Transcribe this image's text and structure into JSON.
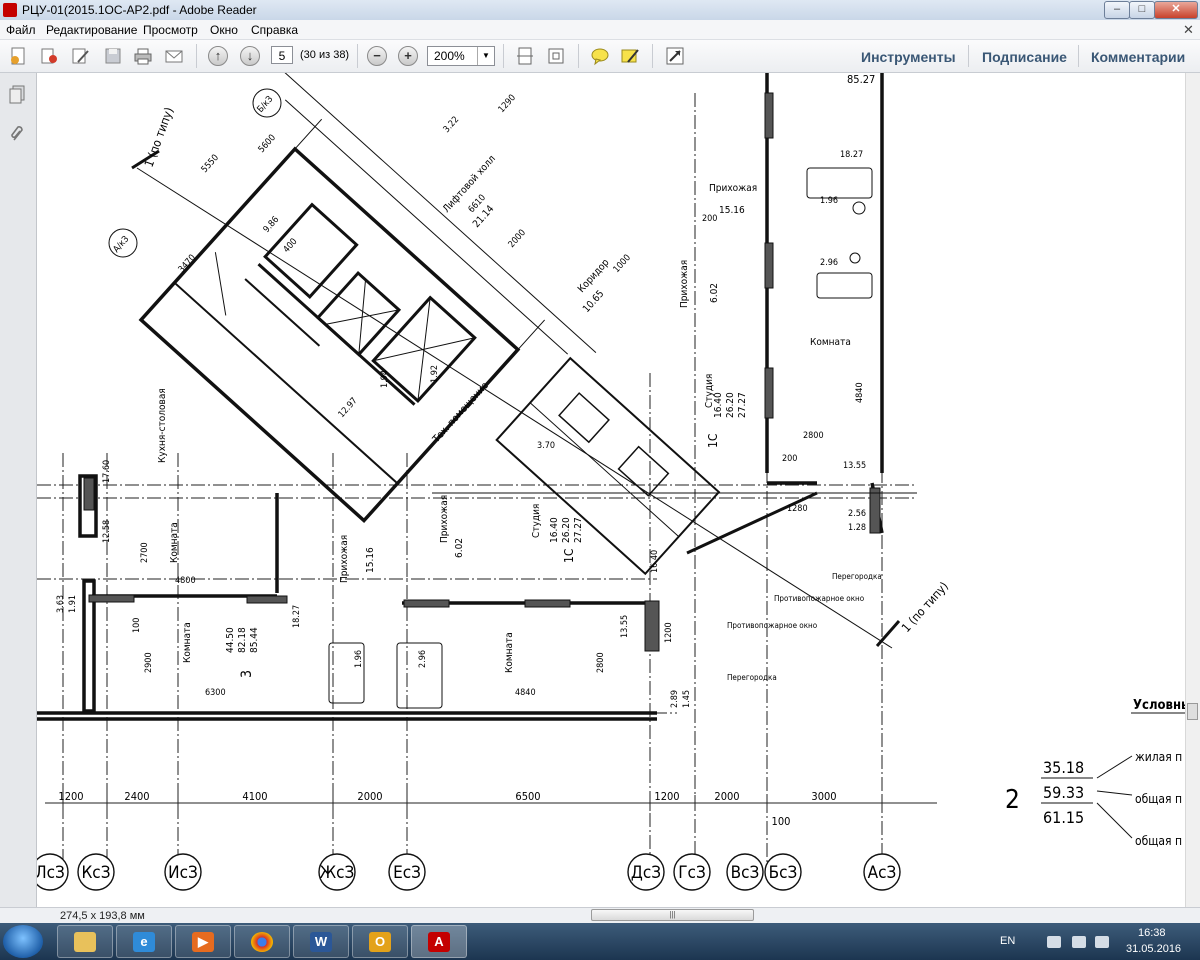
{
  "window": {
    "title": "РЦУ-01(2015.1ОС-АР2.pdf - Adobe Reader",
    "minimize": "–",
    "maximize": "□",
    "close": "✕"
  },
  "menu": {
    "items": [
      "Файл",
      "Редактирование",
      "Просмотр",
      "Окно",
      "Справка"
    ],
    "close_doc": "✕"
  },
  "toolbar": {
    "page_number": "5",
    "page_count": "(30 из 38)",
    "zoom_minus": "−",
    "zoom_plus": "+",
    "zoom": "200%",
    "right_links": [
      "Инструменты",
      "Подписание",
      "Комментарии"
    ]
  },
  "status": {
    "page_size": "274,5 x 193,8 мм",
    "scroll_grip": "|||"
  },
  "taskbar": {
    "lang": "EN",
    "time": "16:38",
    "date": "31.05.2016",
    "apps": [
      "explorer",
      "internet-explorer",
      "media-player",
      "chrome",
      "word",
      "outlook",
      "acrobat-reader"
    ]
  },
  "drawing": {
    "axes": [
      "ЛсЗ",
      "КсЗ",
      "ИсЗ",
      "ЖсЗ",
      "ЕсЗ",
      "ДсЗ",
      "ГсЗ",
      "ВсЗ",
      "БсЗ",
      "АсЗ"
    ],
    "bottom_dims": [
      "1200",
      "2400",
      "4100",
      "2000",
      "6500",
      "1200",
      "2000",
      "3000",
      "100"
    ],
    "apt_number": "2",
    "apt_areas": [
      "35.18",
      "59.33",
      "61.15"
    ],
    "legend_title": "Условные",
    "legend_items": [
      "жилая п",
      "общая п",
      "общая п"
    ],
    "rooms": {
      "kitchen": "Кухня-столовая",
      "room_left": "Комната",
      "room_small": "Комната",
      "hall_mid": "Прихожая",
      "hall_mid_area": "15.16",
      "hall2": "Прихожая",
      "hall2_area": "6.02",
      "studio": "Студия",
      "studio_values": [
        "1С",
        "16.40",
        "26.20",
        "27.27"
      ],
      "room_right": "Комната",
      "hall_right": "Прихожая",
      "hall_right_area": "15.16",
      "studio_r": "Студия",
      "studio_r_values": [
        "1С",
        "16.40",
        "26.20",
        "27.27"
      ],
      "hall_r2": "Прихожая",
      "hall_r2_area": "6.02",
      "room_r": "Комната",
      "apt3_values": [
        "44.50",
        "82.18",
        "85.44"
      ],
      "apt3_number": "3",
      "corridor": "Коридор",
      "corridor_area": "10.65",
      "lift_hall": "Лифтовой холл",
      "lift_hall_area": "21.14",
      "tech": "Тех. помещение",
      "partition1": "Перегородка",
      "partition2": "Перегородка",
      "partition3": "Перегородка",
      "fire_window1": "Противопожарное окно",
      "fire_window2": "Противопожарное окно",
      "section_label": "1 (по типу)",
      "section_label2": "1 (по типу)",
      "axis_a": "А/кЗ",
      "axis_b": "Б/кЗ",
      "top_area": "85.27"
    },
    "dims": [
      "5550",
      "5600",
      "3470",
      "9.86",
      "400",
      "6610",
      "2000",
      "1000",
      "3.70",
      "12.58",
      "17.60",
      "2700",
      "4800",
      "100",
      "2900",
      "6300",
      "4840",
      "2800",
      "13.55",
      "18.27",
      "1.96",
      "2.96",
      "2800",
      "13.55",
      "1280",
      "2.56",
      "1.28",
      "200",
      "1200",
      "2.89",
      "1.45",
      "3.63",
      "1.91",
      "16.40",
      "3.22",
      "1290",
      "12.97",
      "1.94",
      "1.92",
      "4840",
      "18.27",
      "1.96",
      "2.96",
      "200"
    ]
  }
}
